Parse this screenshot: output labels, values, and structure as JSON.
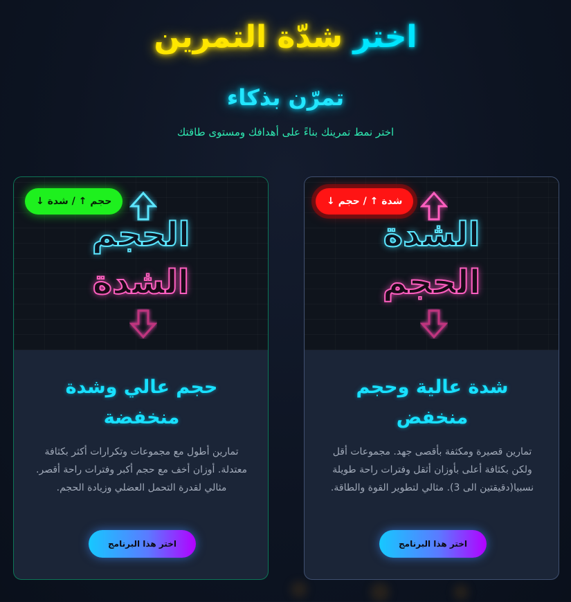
{
  "hero": {
    "title_part1": "اختر",
    "title_part2": "شدّة التمرين",
    "subtitle": "تمرّن بذكاء",
    "lead": "اختر نمط تمرينك بناءً على أهدافك ومستوى طاقتك"
  },
  "colors": {
    "accent_cyan": "#00e5ff",
    "accent_yellow": "#ffe600",
    "accent_green": "#1ef01e",
    "accent_red": "#ff1414",
    "lead_text": "#2ee8b0",
    "card_bg": "#1b2537"
  },
  "cards": [
    {
      "badge": "حجم ↑ / شدة ↓",
      "media_top_word": "الحجم",
      "media_bottom_word": "الشدة",
      "title": "حجم عالي وشدة منخفضة",
      "description": "تمارين أطول مع مجموعات وتكرارات أكثر بكثافة معتدلة. أوزان أخف مع حجم أكبر وفترات راحة أقصر. مثالي لقدرة التحمل العضلي وزيادة الحجم.",
      "button": "اختر هذا البرنامج",
      "icons": [
        "arrow-up-icon",
        "arrow-down-icon"
      ]
    },
    {
      "badge": "شدة ↑ / حجم ↓",
      "media_top_word": "الشدة",
      "media_bottom_word": "الحجم",
      "title": "شدة عالية وحجم منخفض",
      "description": "تمارين قصيرة ومكثفة بأقصى جهد. مجموعات أقل ولكن بكثافة أعلى بأوزان أثقل وفترات راحة طويلة نسبيا(دقيقتين الى 3). مثالي لتطوير القوة والطاقة.",
      "button": "اختر هذا البرنامج",
      "icons": [
        "arrow-up-icon",
        "arrow-down-icon"
      ]
    }
  ]
}
